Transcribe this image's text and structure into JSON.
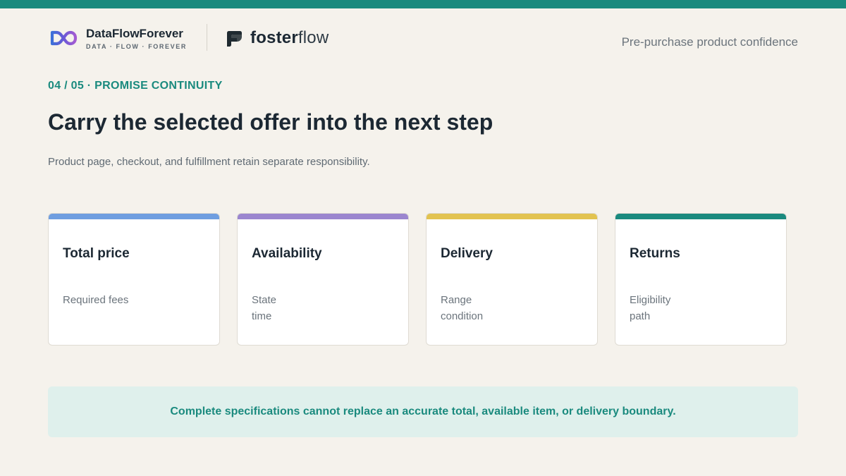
{
  "colors": {
    "brand_teal": "#1a8a7e",
    "background": "#f5f2ec",
    "note_background": "#dff0ec"
  },
  "header": {
    "brand": {
      "name": "DataFlowForever",
      "tagline": "DATA · FLOW · FOREVER",
      "icon": "infinity-logo-icon"
    },
    "partner": {
      "name_bold": "foster",
      "name_light": "flow",
      "icon": "fosterflow-leaf-logo-icon"
    },
    "right_label": "Pre-purchase product confidence"
  },
  "slide": {
    "eyebrow": "04 / 05 · PROMISE CONTINUITY",
    "title": "Carry the selected offer into the next step",
    "subtitle": "Product page, checkout, and fulfillment retain separate responsibility."
  },
  "cards": [
    {
      "title": "Total price",
      "lines": [
        "Required fees",
        ""
      ],
      "accent": "#6f9ee0"
    },
    {
      "title": "Availability",
      "lines": [
        "State",
        "time"
      ],
      "accent": "#9b86cf"
    },
    {
      "title": "Delivery",
      "lines": [
        "Range",
        "condition"
      ],
      "accent": "#e2c350"
    },
    {
      "title": "Returns",
      "lines": [
        "Eligibility",
        "path"
      ],
      "accent": "#1a8a7e"
    }
  ],
  "note": {
    "text": "Complete specifications cannot replace an accurate total, available item, or delivery boundary."
  }
}
